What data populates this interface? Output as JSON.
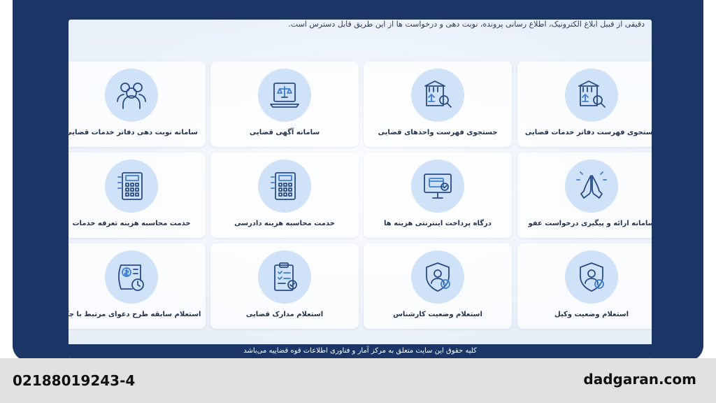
{
  "intro_text": "دقیقی از قبیل ابلاغ الکترونیک، اطلاع رسانی پرونده، نوبت دهی و درخواست ها از این طریق قابل دسترس است.",
  "services": [
    {
      "label": "جستجوی فهرست دفاتر خدمات قضایی",
      "icon": "building-search-icon"
    },
    {
      "label": "جستجوی فهرست واحدهای قضایی",
      "icon": "building-search-icon"
    },
    {
      "label": "سامانه آگهی قضایی",
      "icon": "laptop-scales-icon"
    },
    {
      "label": "سامانه نوبت دهی دفاتر خدمات قضایی",
      "icon": "people-group-icon"
    },
    {
      "label": "سامانه ارائه و پیگیری درخواست عفو",
      "icon": "praying-hands-icon"
    },
    {
      "label": "درگاه پرداخت اینترنتی هزینه ها",
      "icon": "monitor-card-icon"
    },
    {
      "label": "خدمت محاسبه هزینه دادرسی",
      "icon": "calculator-icon"
    },
    {
      "label": "خدمت محاسبه هزینه تعرفه خدمات",
      "icon": "calculator-icon"
    },
    {
      "label": "استعلام وضعیت وکیل",
      "icon": "shield-person-icon"
    },
    {
      "label": "استعلام وضعیت کارشناس",
      "icon": "shield-person-icon"
    },
    {
      "label": "استعلام مدارک قضایی",
      "icon": "clipboard-check-icon"
    },
    {
      "label": "استعلام سابقه طرح دعوای مرتبط با چک",
      "icon": "cheque-clock-icon"
    }
  ],
  "footer_text": "کلیه حقوق این سایت متعلق به مرکز آمار و فناوری اطلاعات قوه قضاییه می‌باشد",
  "banner": {
    "phone": "02188019243-4",
    "site": "dadgaran.com"
  },
  "colors": {
    "frame": "#1b3566",
    "icon_bg": "#cfe2f7",
    "icon_stroke": "#2a4b86",
    "icon_accent": "#3f7fd0"
  }
}
